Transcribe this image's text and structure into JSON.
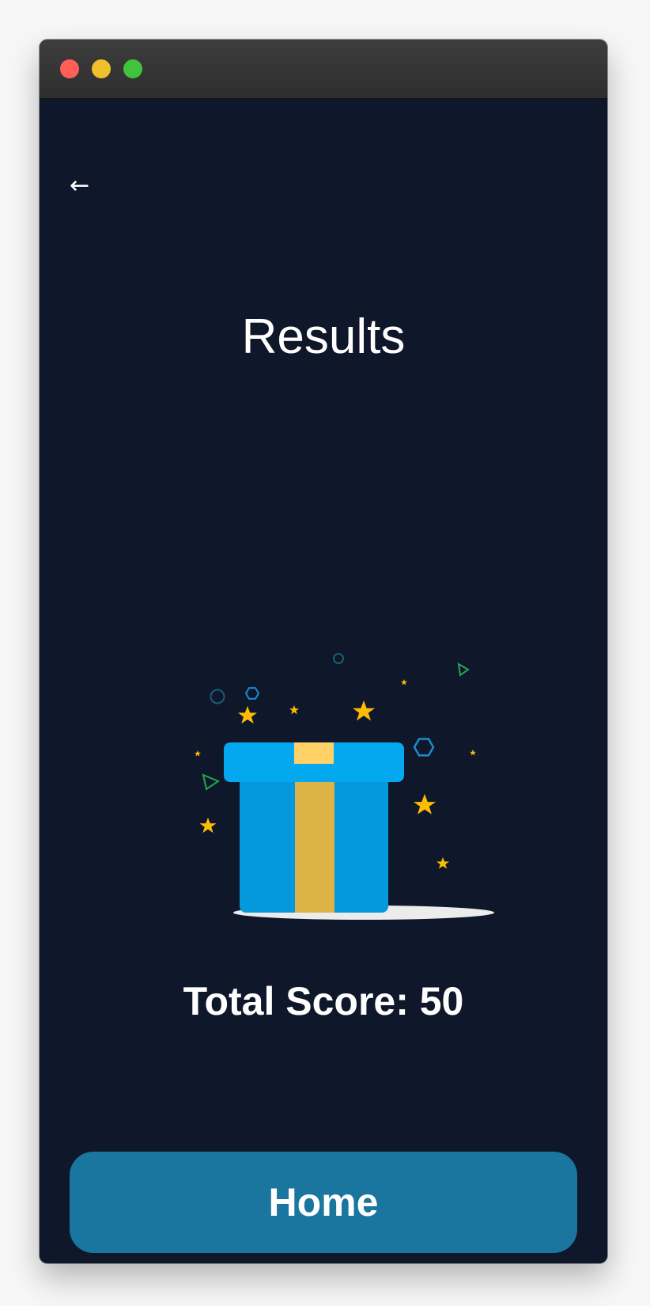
{
  "window": {
    "controls": {
      "close_color": "#ff5f57",
      "minimize_color": "#f0c02a",
      "maximize_color": "#3fc43a"
    }
  },
  "header": {
    "back_icon": "←",
    "title": "Results"
  },
  "illustration": {
    "name": "gift-box-with-confetti",
    "box_color": "#0399db",
    "lid_color": "#04a8ef",
    "ribbon_color": "#dcb347",
    "ribbon_top_color": "#ffd166",
    "star_color": "#fbbc05"
  },
  "result": {
    "score_text": "Total Score: 50"
  },
  "actions": {
    "home_label": "Home",
    "home_color": "#1a759f"
  }
}
